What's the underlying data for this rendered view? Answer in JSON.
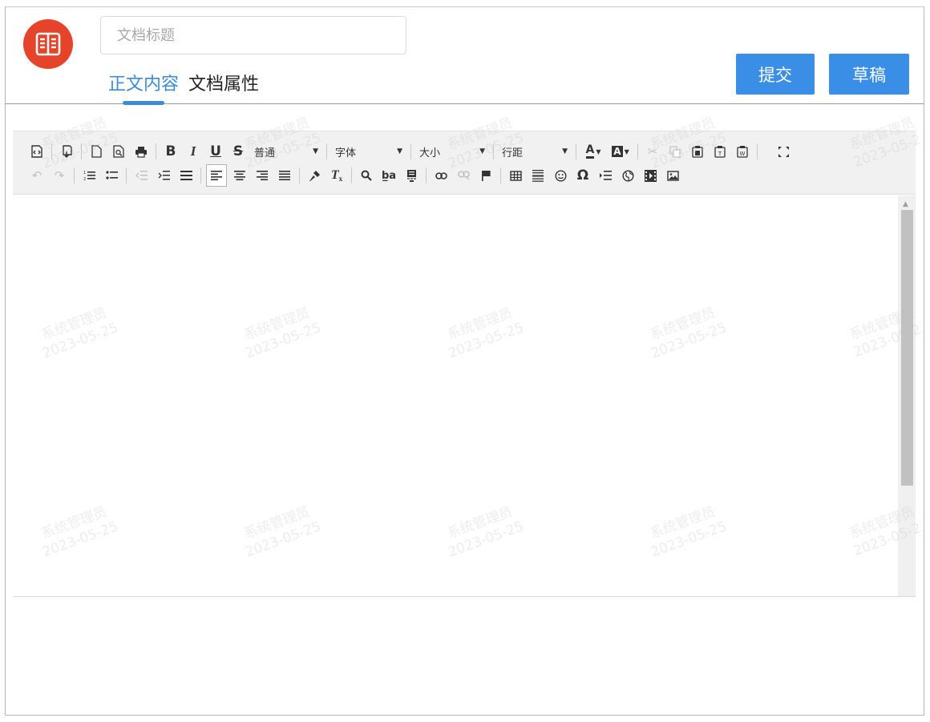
{
  "header": {
    "title_placeholder": "文档标题",
    "tabs": [
      {
        "label": "正文内容",
        "active": true
      },
      {
        "label": "文档属性",
        "active": false
      }
    ],
    "buttons": {
      "submit": "提交",
      "draft": "草稿"
    }
  },
  "toolbar": {
    "paragraph_select": "普通",
    "font_select": "字体",
    "size_select": "大小",
    "lineheight_select": "行距"
  },
  "watermark": {
    "name": "系统管理员",
    "date": "2023-05-25"
  },
  "colors": {
    "accent": "#3a8ee6",
    "logo": "#e5432a",
    "tab_active": "#3b8bd9"
  }
}
